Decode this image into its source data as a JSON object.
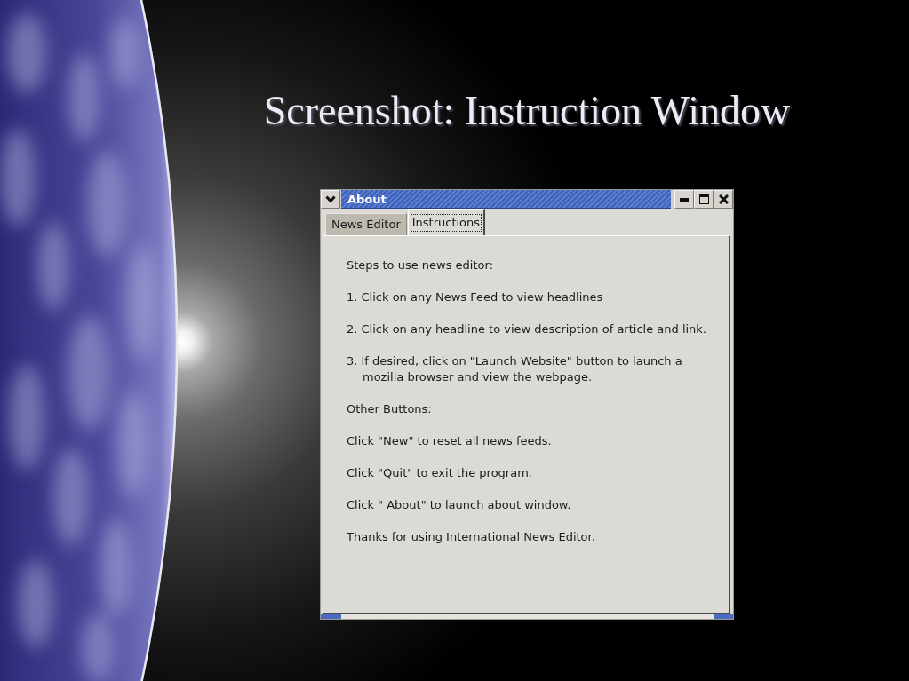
{
  "slide": {
    "title": "Screenshot: Instruction Window"
  },
  "window": {
    "title": "About",
    "tabs": [
      {
        "label": "News Editor",
        "selected": false
      },
      {
        "label": "Instructions",
        "selected": true
      }
    ],
    "paragraphs": [
      "Steps to use news editor:",
      "1. Click on any News Feed to view headlines",
      "2. Click on any headline to view description of article and link.",
      "3. If desired, click on \"Launch Website\" button to launch a\nmozilla browser and view the webpage.",
      "Other Buttons:",
      "Click \"New\" to reset all news feeds.",
      "Click \"Quit\" to exit the program.",
      "Click \" About\" to launch about window.",
      "Thanks for using International News Editor."
    ]
  }
}
